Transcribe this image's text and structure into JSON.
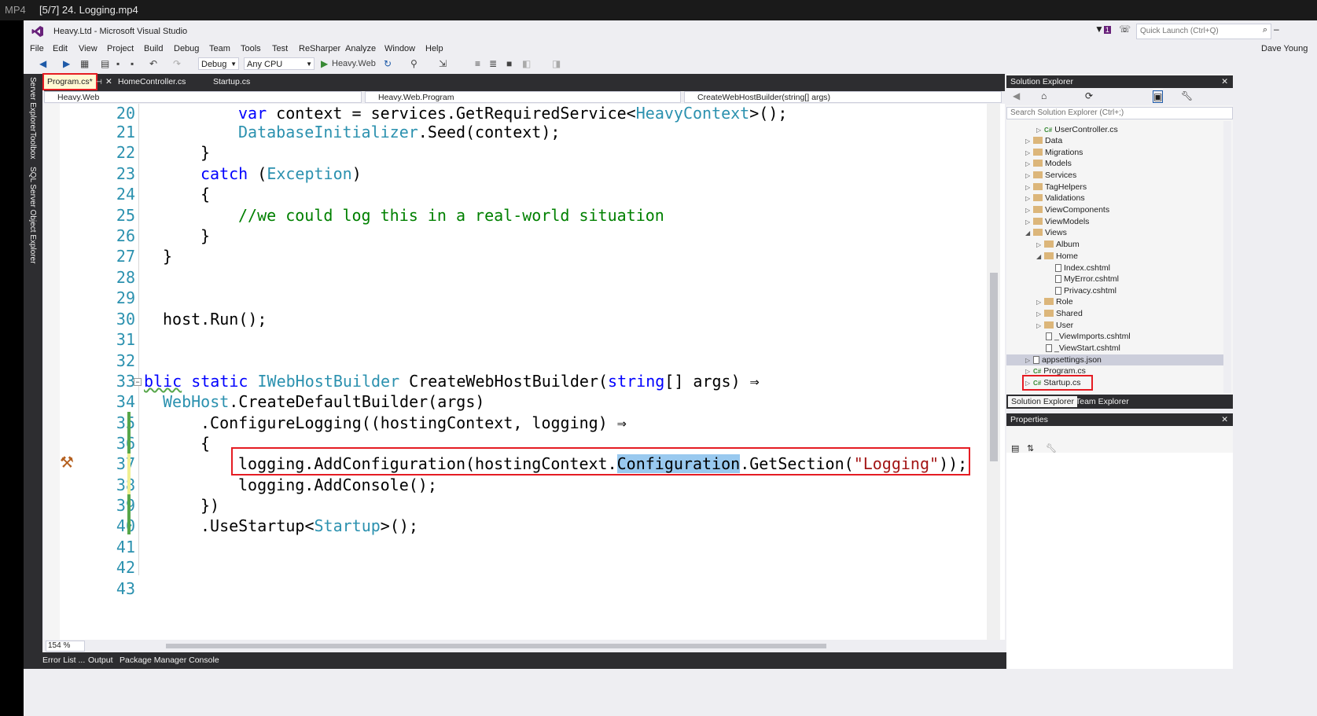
{
  "player": {
    "format": "MP4",
    "title": "[5/7] 24. Logging.mp4"
  },
  "app": {
    "title": "Heavy.Ltd - Microsoft Visual Studio",
    "user": "Dave Young",
    "notification_count": "1"
  },
  "quick_launch": {
    "placeholder": "Quick Launch (Ctrl+Q)"
  },
  "menu": [
    "File",
    "Edit",
    "View",
    "Project",
    "Build",
    "Debug",
    "Team",
    "Tools",
    "Test",
    "ReSharper",
    "Analyze",
    "Window",
    "Help"
  ],
  "toolbar": {
    "config": "Debug",
    "platform": "Any CPU",
    "start_target": "Heavy.Web"
  },
  "side_tabs": [
    "Server Explorer",
    "Toolbox",
    "SQL Server Object Explorer"
  ],
  "doc_tabs": [
    "Program.cs*",
    "HomeController.cs",
    "Startup.cs"
  ],
  "nav": {
    "project": "Heavy.Web",
    "type": "Heavy.Web.Program",
    "member": "CreateWebHostBuilder(string[] args)"
  },
  "code_lines": [
    "20",
    "21",
    "22",
    "23",
    "24",
    "25",
    "26",
    "27",
    "28",
    "29",
    "30",
    "31",
    "32",
    "33",
    "34",
    "35",
    "36",
    "37",
    "38",
    "39",
    "40",
    "41",
    "42",
    "43"
  ],
  "code": {
    "l20": [
      "var",
      " context = services.GetRequiredService<",
      "HeavyContext",
      ">();"
    ],
    "l21": [
      "DatabaseInitializer",
      ".Seed(context);"
    ],
    "l22": "}",
    "l23": [
      "catch",
      " (",
      "Exception",
      ")"
    ],
    "l24": "{",
    "l25": "//we could log this in a real-world situation",
    "l26": "}",
    "l27": "}",
    "l30": "host.Run();",
    "l33": [
      "blic",
      " ",
      "static",
      " ",
      "IWebHostBuilder",
      " CreateWebHostBuilder(",
      "string",
      "[] args) ⇒"
    ],
    "l34": [
      "WebHost",
      ".CreateDefaultBuilder(args)"
    ],
    "l35": ".ConfigureLogging((hostingContext, logging) ⇒",
    "l36": "{",
    "l37": [
      "logging.AddConfiguration(hostingContext.",
      "Configuration",
      ".GetSection(",
      "\"Logging\"",
      "));"
    ],
    "l38": "logging.AddConsole();",
    "l39": "})",
    "l40": [
      ".UseStartup<",
      "Startup",
      ">();"
    ]
  },
  "zoom": "154 %",
  "bottom_tabs": [
    "Error List ...",
    "Output",
    "Package Manager Console"
  ],
  "solution_explorer": {
    "title": "Solution Explorer",
    "search_placeholder": "Search Solution Explorer (Ctrl+;)",
    "items": [
      "UserController.cs",
      "Data",
      "Migrations",
      "Models",
      "Services",
      "TagHelpers",
      "Validations",
      "ViewComponents",
      "ViewModels",
      "Views",
      "Album",
      "Home",
      "Index.cshtml",
      "MyError.cshtml",
      "Privacy.cshtml",
      "Role",
      "Shared",
      "User",
      "_ViewImports.cshtml",
      "_ViewStart.cshtml",
      "appsettings.json",
      "Program.cs",
      "Startup.cs"
    ],
    "tabs": [
      "Solution Explorer",
      "Team Explorer"
    ]
  },
  "properties": {
    "title": "Properties"
  },
  "colors": {
    "accent": "#68217a",
    "highlight_box": "#e51c23",
    "selection": "#99c9ef"
  }
}
